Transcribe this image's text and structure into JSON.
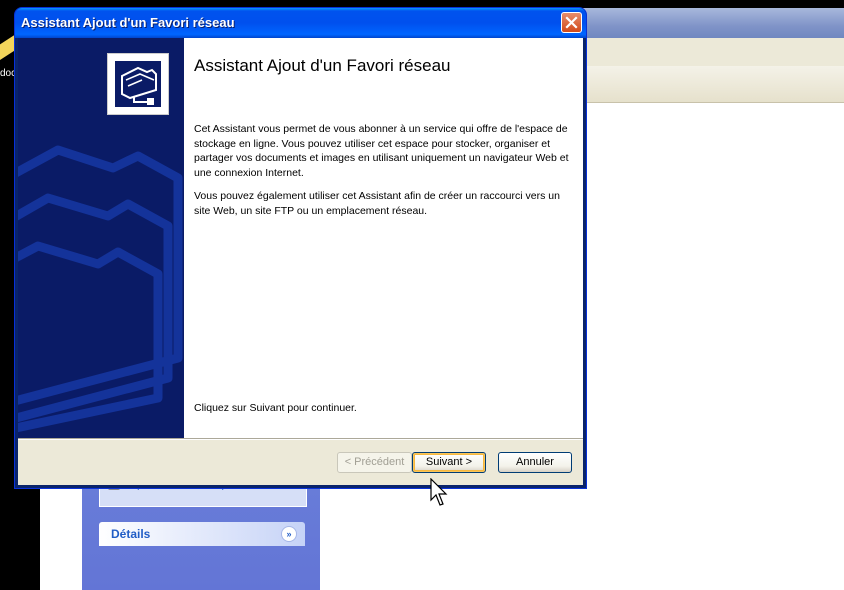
{
  "desktop": {
    "icon_label": "doc"
  },
  "background_window": {
    "task_item_label": "Imprimantes et télécopieurs",
    "details_label": "Détails",
    "details_toggle": "»"
  },
  "dialog": {
    "title": "Assistant Ajout d'un Favori réseau",
    "heading": "Assistant Ajout d'un Favori réseau",
    "paragraph1": "Cet Assistant vous permet de vous abonner à un service qui offre de l'espace de stockage en ligne. Vous pouvez utiliser cet espace pour stocker, organiser et partager vos documents et images en utilisant uniquement un navigateur Web et une connexion Internet.",
    "paragraph2": "Vous pouvez également utiliser cet Assistant afin de créer un raccourci vers un site Web, un site FTP ou un emplacement réseau.",
    "instruction": "Cliquez sur Suivant pour continuer.",
    "buttons": {
      "previous": "< Précédent",
      "next": "Suivant >",
      "cancel": "Annuler"
    },
    "icons": {
      "close": "close-icon",
      "logo": "network-place-icon"
    }
  },
  "colors": {
    "titlebar": "#0053ee",
    "side_panel": "#0a1b66",
    "dialog_bg": "#ece9d8",
    "task_pane": "#6375d6"
  }
}
